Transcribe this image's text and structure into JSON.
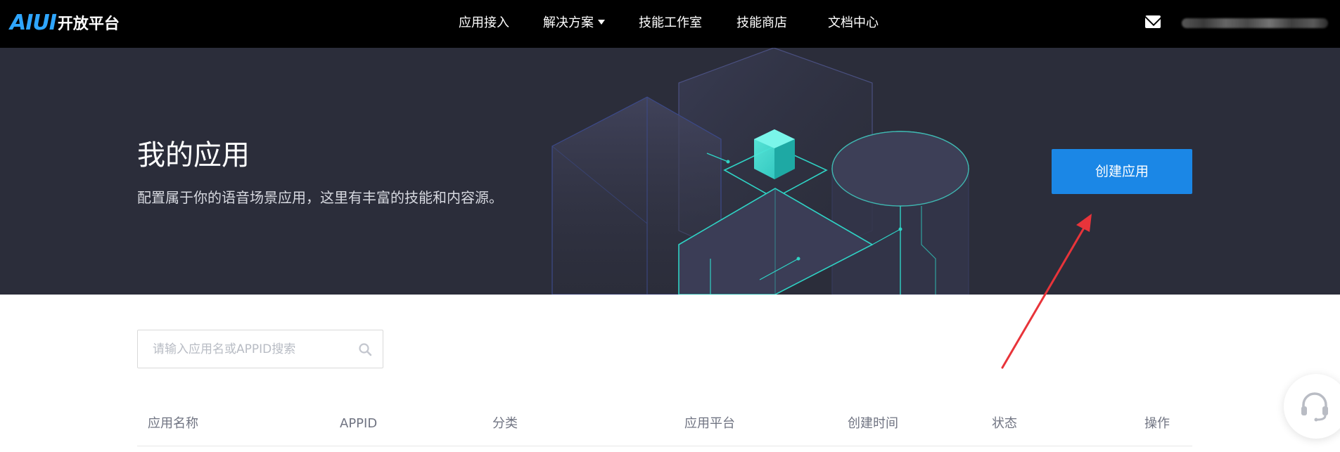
{
  "brand": {
    "logo_mark": "AIUI",
    "logo_text": "开放平台"
  },
  "nav": {
    "items": [
      {
        "label": "应用接入",
        "has_dropdown": false
      },
      {
        "label": "解决方案",
        "has_dropdown": true
      },
      {
        "label": "技能工作室",
        "has_dropdown": false
      },
      {
        "label": "技能商店",
        "has_dropdown": false
      },
      {
        "label": "文档中心",
        "has_dropdown": false
      }
    ],
    "mail_icon": "mail-icon"
  },
  "hero": {
    "title": "我的应用",
    "subtitle": "配置属于你的语音场景应用，这里有丰富的技能和内容源。",
    "create_button": "创建应用"
  },
  "search": {
    "placeholder": "请输入应用名或APPID搜索",
    "value": "",
    "icon": "search-icon"
  },
  "table": {
    "columns": [
      "应用名称",
      "APPID",
      "分类",
      "应用平台",
      "创建时间",
      "状态",
      "操作"
    ]
  },
  "colors": {
    "nav_bg": "#000000",
    "hero_bg": "#2b2d3a",
    "accent": "#1b87e6",
    "annotation_arrow": "#e8343a"
  }
}
